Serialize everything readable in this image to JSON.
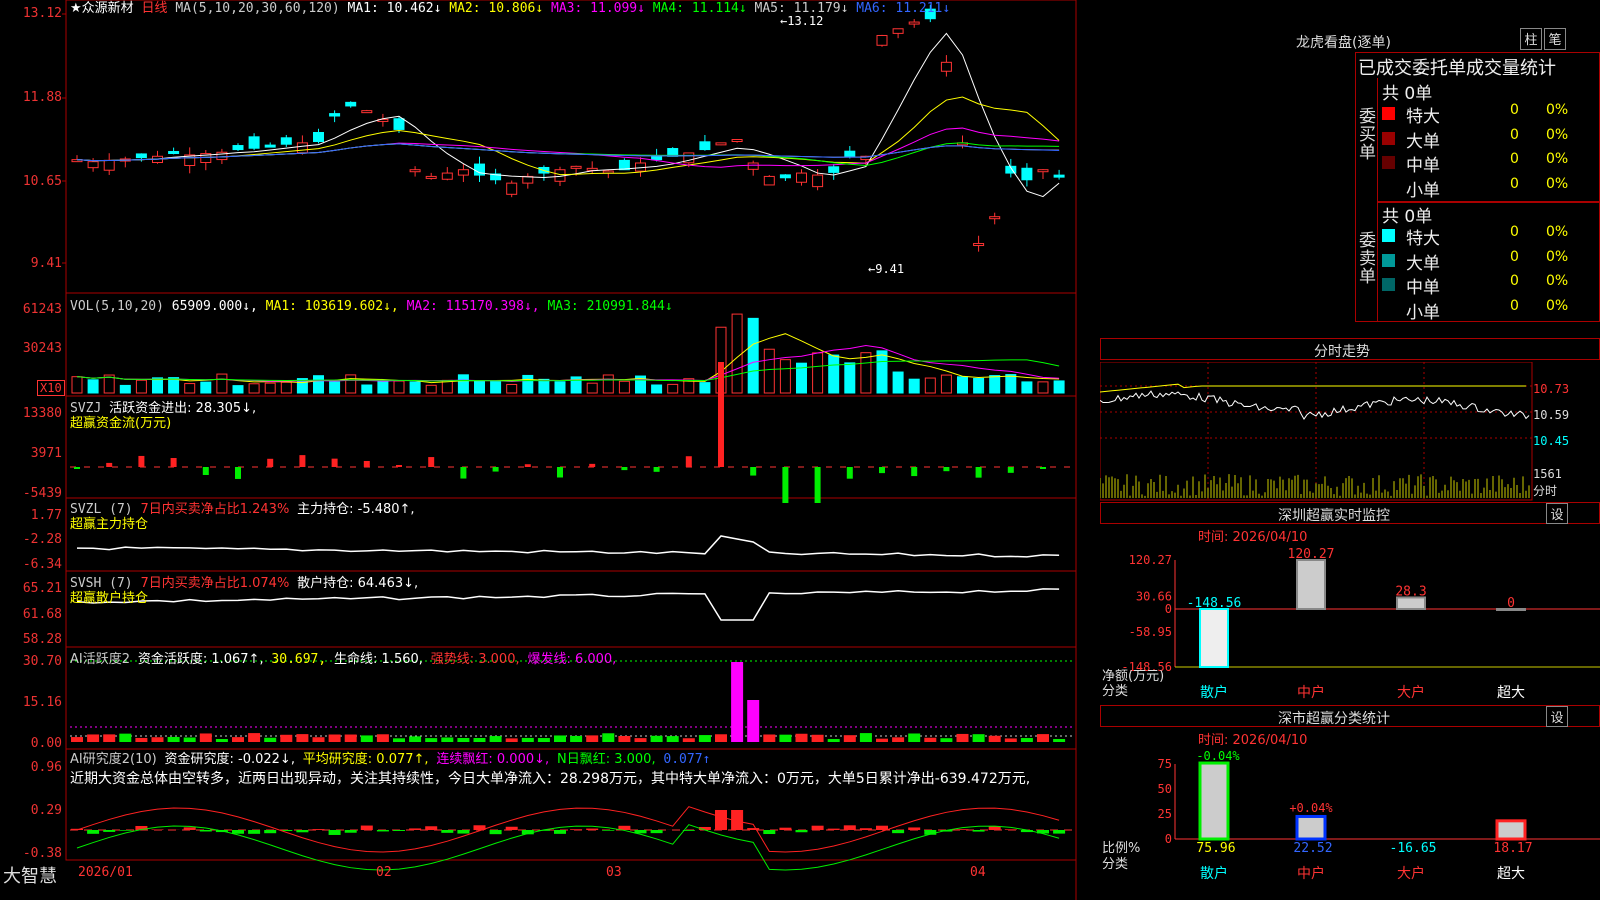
{
  "header": {
    "stock_name": "★众源新材",
    "period": "日线",
    "ma_label": "MA(5,10,20,30,60,120)",
    "ma_values": [
      {
        "name": "MA1",
        "text": "MA1: 10.462↓",
        "color": "#ffffff"
      },
      {
        "name": "MA2",
        "text": "MA2: 10.806↓",
        "color": "#ffff00"
      },
      {
        "name": "MA3",
        "text": "MA3: 11.099↓",
        "color": "#ff00ff"
      },
      {
        "name": "MA4",
        "text": "MA4: 11.114↓",
        "color": "#00ff00"
      },
      {
        "name": "MA5",
        "text": "MA5: 11.179↓",
        "color": "#cccccc"
      },
      {
        "name": "MA6",
        "text": "MA6: 11.211↓",
        "color": "#3366ff"
      }
    ]
  },
  "price_panel": {
    "y_labels": [
      "13.12",
      "11.88",
      "10.65",
      "9.41"
    ],
    "high_note": "13.12",
    "low_note": "9.41"
  },
  "vol_panel": {
    "label": "VOL(5,10,20)",
    "vol": "65909.000↓,",
    "ma1": "MA1: 103619.602↓,",
    "ma2": "MA2: 115170.398↓,",
    "ma3": "MA3: 210991.844↓",
    "y_labels": [
      "61243",
      "30243"
    ],
    "unit": "X10"
  },
  "svzj": {
    "title": "SVZJ",
    "text": "活跃资金进出: 28.305↓,",
    "subtitle": "超赢资金流(万元)",
    "y_labels": [
      "13380",
      "3971",
      "-5439"
    ]
  },
  "svzl": {
    "title": "SVZL (7)",
    "text1": "7日内买卖净占比1.243%",
    "text2": "主力持仓: -5.480↑,",
    "subtitle": "超赢主力持仓",
    "y_labels": [
      "1.77",
      "-2.28",
      "-6.34"
    ]
  },
  "svsh": {
    "title": "SVSH (7)",
    "text1": "7日内买卖净占比1.074%",
    "text2": "散户持仓: 64.463↓,",
    "subtitle": "超赢散户持仓",
    "y_labels": [
      "65.21",
      "61.68",
      "58.28"
    ]
  },
  "ai1": {
    "title": "AI活跃度2",
    "t1": "资金活跃度: 1.067↑,",
    "t2": "30.697,",
    "t3": "生命线: 1.560,",
    "t4": "强势线: 3.000,",
    "t5": "爆发线: 6.000,",
    "y_labels": [
      "30.70",
      "15.16",
      "0.00"
    ]
  },
  "ai2": {
    "title": "AI研究度2(10)",
    "t1": "资金研究度: -0.022↓,",
    "t2": "平均研究度: 0.077↑,",
    "t3": "连续飘红: 0.000↓,",
    "t4": "N日飘红: 3.000,",
    "t5": "0.077↑",
    "comment": "近期大资金总体由空转多，近两日出现异动，关注其持续性，今日大单净流入：28.298万元，其中特大单净流入：0万元，大单5日累计净出-639.472万元,",
    "y_labels": [
      "0.96",
      "0.29",
      "-0.38"
    ]
  },
  "xaxis": {
    "brand": "大智慧",
    "labels": [
      "2026/01",
      "02",
      "03",
      "04"
    ]
  },
  "lhb": {
    "title": "龙虎看盘(逐单)",
    "btn_zhu": "柱",
    "btn_bi": "笔",
    "subtitle": "已成交委托单成交量统计",
    "buy_label": "委买单",
    "sell_label": "委卖单",
    "buy_total": "共 0单",
    "sell_total": "共 0单",
    "buy_rows": [
      {
        "name": "特大",
        "count": "0",
        "pct": "0%",
        "color": "#ff0000"
      },
      {
        "name": "大单",
        "count": "0",
        "pct": "0%",
        "color": "#990000"
      },
      {
        "name": "中单",
        "count": "0",
        "pct": "0%",
        "color": "#660000"
      },
      {
        "name": "小单",
        "count": "0",
        "pct": "0%",
        "color": ""
      }
    ],
    "sell_rows": [
      {
        "name": "特大",
        "count": "0",
        "pct": "0%",
        "color": "#00ffff"
      },
      {
        "name": "大单",
        "count": "0",
        "pct": "0%",
        "color": "#009999"
      },
      {
        "name": "中单",
        "count": "0",
        "pct": "0%",
        "color": "#006666"
      },
      {
        "name": "小单",
        "count": "0",
        "pct": "0%",
        "color": ""
      }
    ]
  },
  "fenshi": {
    "title": "分时走势",
    "y_labels": [
      "10.73",
      "10.59",
      "10.45"
    ],
    "vol_label": "1561",
    "unit": "分时"
  },
  "monitor": {
    "title": "深圳超赢实时监控",
    "btn": "设",
    "time": "时间: 2026/04/10",
    "y_labels": [
      "120.27",
      "30.66",
      "0",
      "-58.95",
      "-148.56"
    ],
    "unit1": "净额(万元)",
    "unit2": "分类",
    "categories": [
      "散户",
      "中户",
      "大户",
      "超大"
    ],
    "values": [
      -148.56,
      120.27,
      28.3,
      0
    ],
    "value_labels": [
      "-148.56",
      "120.27",
      "28.3",
      "0"
    ]
  },
  "classify": {
    "title": "深市超赢分类统计",
    "btn": "设",
    "time": "时间: 2026/04/10",
    "y_labels": [
      "75",
      "50",
      "25",
      "0"
    ],
    "unit1": "比例%",
    "unit2": "分类",
    "categories": [
      "散户",
      "中户",
      "大户",
      "超大"
    ],
    "values": [
      75.96,
      22.52,
      -16.65,
      18.17
    ],
    "value_labels": [
      "75.96",
      "22.52",
      "-16.65",
      "18.17"
    ],
    "change_labels": [
      "-0.04%",
      "+0.04%"
    ]
  },
  "chart_data": {
    "type": "bar",
    "title": "深圳超赢实时监控",
    "categories": [
      "散户",
      "中户",
      "大户",
      "超大"
    ],
    "series": [
      {
        "name": "净额(万元)",
        "values": [
          -148.56,
          120.27,
          28.3,
          0
        ]
      },
      {
        "name": "比例%",
        "values": [
          75.96,
          22.52,
          -16.65,
          18.17
        ]
      }
    ],
    "price_range": [
      9.41,
      13.12
    ],
    "grid": false
  }
}
